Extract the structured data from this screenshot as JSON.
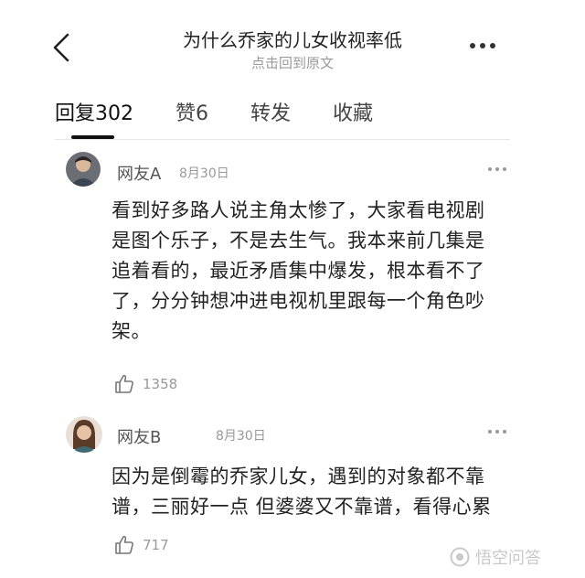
{
  "header": {
    "title": "为什么乔家的儿女收视率低",
    "subtitle": "点击回到原文"
  },
  "tabs": [
    {
      "label": "回复",
      "count": "302"
    },
    {
      "label": "赞",
      "count": "6"
    },
    {
      "label": "转发",
      "count": ""
    },
    {
      "label": "收藏",
      "count": ""
    }
  ],
  "comments": [
    {
      "name": "网友A",
      "date": "8月30日",
      "lines": [
        "看到好多路人说主角太惨了，大家看电视剧",
        "是图个乐子，不是去生气。我本来前几集是",
        "追着看的，最近矛盾集中爆发，根本看不了",
        "了，分分钟想冲进电视机里跟每一个角色吵",
        "架。"
      ],
      "likes": "1358"
    },
    {
      "name": "网友B",
      "date": "8月30日",
      "lines": [
        "因为是倒霉的乔家儿女，遇到的对象都不靠",
        "谱，三丽好一点 但婆婆又不靠谱，看得心累"
      ],
      "likes": "717"
    }
  ],
  "watermark": "悟空问答",
  "colors": {
    "accent": "#111111",
    "muted": "#999999"
  }
}
